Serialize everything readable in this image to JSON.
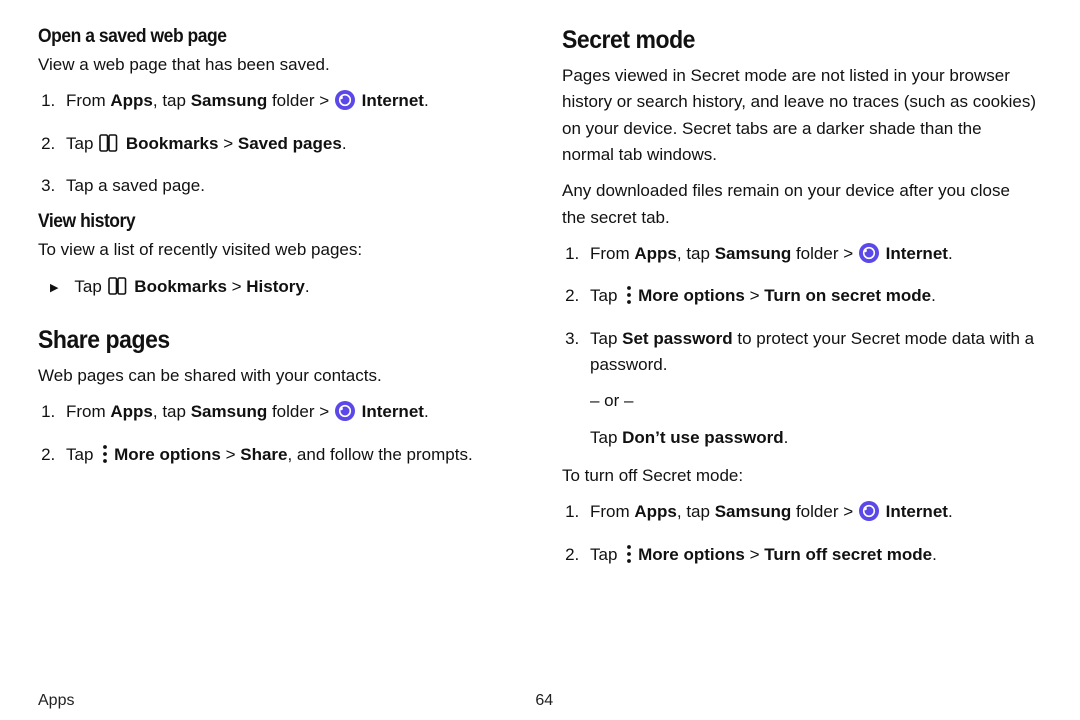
{
  "left": {
    "open_saved": {
      "heading": "Open a saved web page",
      "intro": "View a web page that has been saved.",
      "step1_a": "From ",
      "step1_b": "Apps",
      "step1_c": ", tap ",
      "step1_d": "Samsung",
      "step1_e": " folder > ",
      "step1_f": "Internet",
      "step1_g": ".",
      "step2_a": "Tap ",
      "step2_b": "Bookmarks",
      "step2_c": " > ",
      "step2_d": "Saved pages",
      "step2_e": ".",
      "step3": "Tap a saved page."
    },
    "view_history": {
      "heading": "View history",
      "intro": "To view a list of recently visited web pages:",
      "step1_a": "Tap ",
      "step1_b": "Bookmarks",
      "step1_c": " > ",
      "step1_d": "History",
      "step1_e": "."
    },
    "share": {
      "heading": "Share pages",
      "intro": "Web pages can be shared with your contacts.",
      "step1_a": "From ",
      "step1_b": "Apps",
      "step1_c": ", tap ",
      "step1_d": "Samsung",
      "step1_e": " folder > ",
      "step1_f": "Internet",
      "step1_g": ".",
      "step2_a": "Tap ",
      "step2_b": "More options",
      "step2_c": " > ",
      "step2_d": "Share",
      "step2_e": ", and follow the prompts."
    }
  },
  "right": {
    "secret": {
      "heading": "Secret mode",
      "intro": "Pages viewed in Secret mode are not listed in your browser history or search history, and leave no traces (such as cookies) on your device. Secret tabs are a darker shade than the normal tab windows.",
      "note": "Any downloaded files remain on your device after you close the secret tab.",
      "step1_a": "From ",
      "step1_b": "Apps",
      "step1_c": ", tap ",
      "step1_d": "Samsung",
      "step1_e": " folder > ",
      "step1_f": "Internet",
      "step1_g": ".",
      "step2_a": "Tap ",
      "step2_b": "More options",
      "step2_c": " > ",
      "step2_d": "Turn on secret mode",
      "step2_e": ".",
      "step3_a": "Tap ",
      "step3_b": "Set password",
      "step3_c": " to protect your Secret mode data with a password.",
      "or": "– or –",
      "step3_alt_a": "Tap ",
      "step3_alt_b": "Don’t use password",
      "step3_alt_c": ".",
      "off_intro": "To turn off Secret mode:",
      "off1_a": "From ",
      "off1_b": "Apps",
      "off1_c": ", tap ",
      "off1_d": "Samsung",
      "off1_e": " folder > ",
      "off1_f": "Internet",
      "off1_g": ".",
      "off2_a": "Tap ",
      "off2_b": "More options",
      "off2_c": " > ",
      "off2_d": "Turn off secret mode",
      "off2_e": "."
    }
  },
  "footer": {
    "section": "Apps",
    "page": "64"
  }
}
